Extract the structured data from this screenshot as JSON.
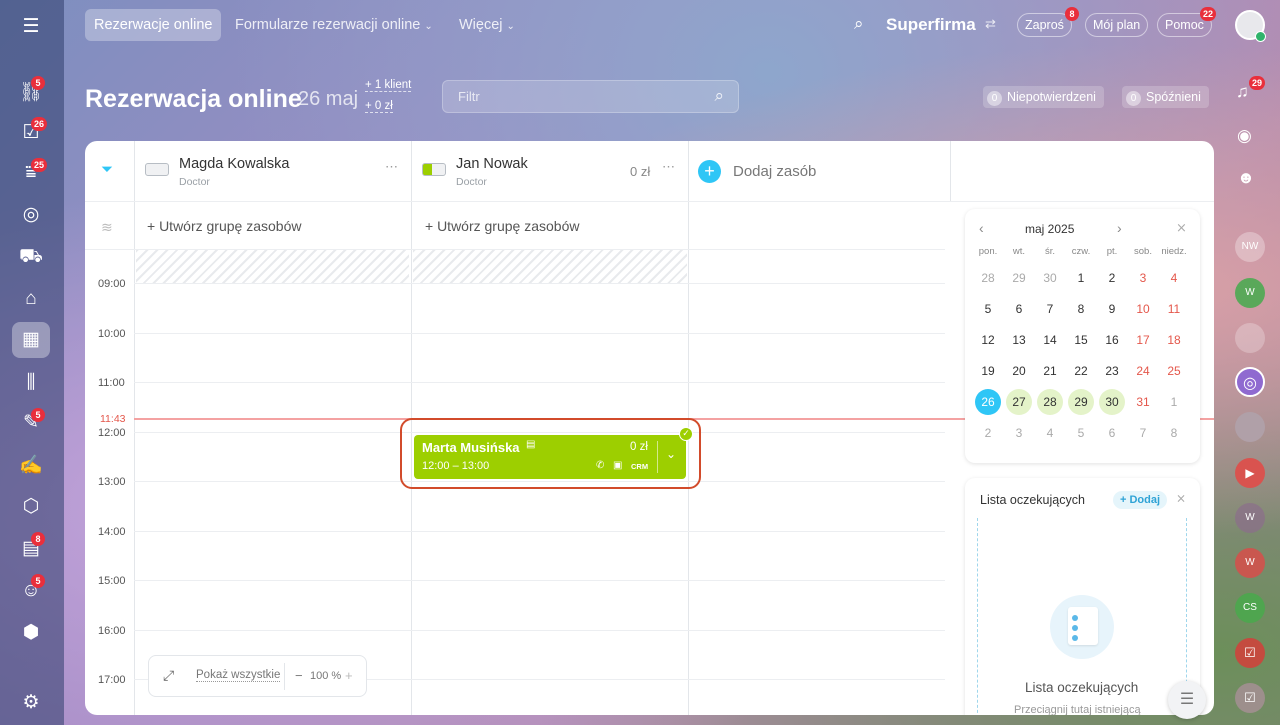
{
  "sidebar": {
    "badges": {
      "b1": "5",
      "b2": "26",
      "b3": "25",
      "b4": "5",
      "b5": "8",
      "b6": "5"
    }
  },
  "topbar": {
    "tab_active": "Rezerwacje online",
    "tab_forms": "Formularze rezerwacji online",
    "tab_more": "Więcej",
    "company": "Superfirma",
    "invite": "Zaproś",
    "invite_badge": "8",
    "plan": "Mój plan",
    "help": "Pomoc",
    "help_badge": "22"
  },
  "header": {
    "title": "Rezerwacja online",
    "date": "26 maj",
    "clients": "+ 1 klient",
    "amount": "+ 0 zł",
    "filter_placeholder": "Filtr",
    "unconfirmed_count": "0",
    "unconfirmed": "Niepotwierdzeni",
    "late_count": "0",
    "late": "Spóźnieni",
    "notif_badge": "29"
  },
  "resources": [
    {
      "name": "Magda Kowalska",
      "role": "Doctor"
    },
    {
      "name": "Jan Nowak",
      "role": "Doctor",
      "amount": "0 zł"
    }
  ],
  "add_resource": "Dodaj zasób",
  "create_group": "+ Utwórz grupę zasobów",
  "times": [
    "09:00",
    "10:00",
    "11:00",
    "12:00",
    "13:00",
    "14:00",
    "15:00",
    "16:00",
    "17:00"
  ],
  "current_time": "11:43",
  "booking": {
    "name": "Marta Musińska",
    "amount": "0 zł",
    "time": "12:00 – 13:00",
    "crm": "CRM"
  },
  "zoom": {
    "show_all": "Pokaż wszystkie",
    "level": "100 %"
  },
  "calendar": {
    "month": "maj 2025",
    "weekdays": [
      "pon.",
      "wt.",
      "śr.",
      "czw.",
      "pt.",
      "sob.",
      "niedz."
    ],
    "rows": [
      [
        "28",
        "29",
        "30",
        "1",
        "2",
        "3",
        "4"
      ],
      [
        "5",
        "6",
        "7",
        "8",
        "9",
        "10",
        "11"
      ],
      [
        "12",
        "13",
        "14",
        "15",
        "16",
        "17",
        "18"
      ],
      [
        "19",
        "20",
        "21",
        "22",
        "23",
        "24",
        "25"
      ],
      [
        "26",
        "27",
        "28",
        "29",
        "30",
        "31",
        "1"
      ],
      [
        "2",
        "3",
        "4",
        "5",
        "6",
        "7",
        "8"
      ]
    ],
    "today": "26"
  },
  "waitlist": {
    "title": "Lista oczekujących",
    "add": "+ Dodaj",
    "empty_title": "Lista oczekujących",
    "empty_sub": "Przeciągnij tutaj istniejącą"
  },
  "right_sidebar": {
    "avatars": [
      "NW",
      "W",
      "W",
      "W",
      "CS"
    ]
  },
  "colors": {
    "accent": "#2fc6f6",
    "booking": "#9dcf00",
    "current_line": "#f4a2a2",
    "weekend": "#e4574b",
    "highlight": "#e4f3c9"
  }
}
